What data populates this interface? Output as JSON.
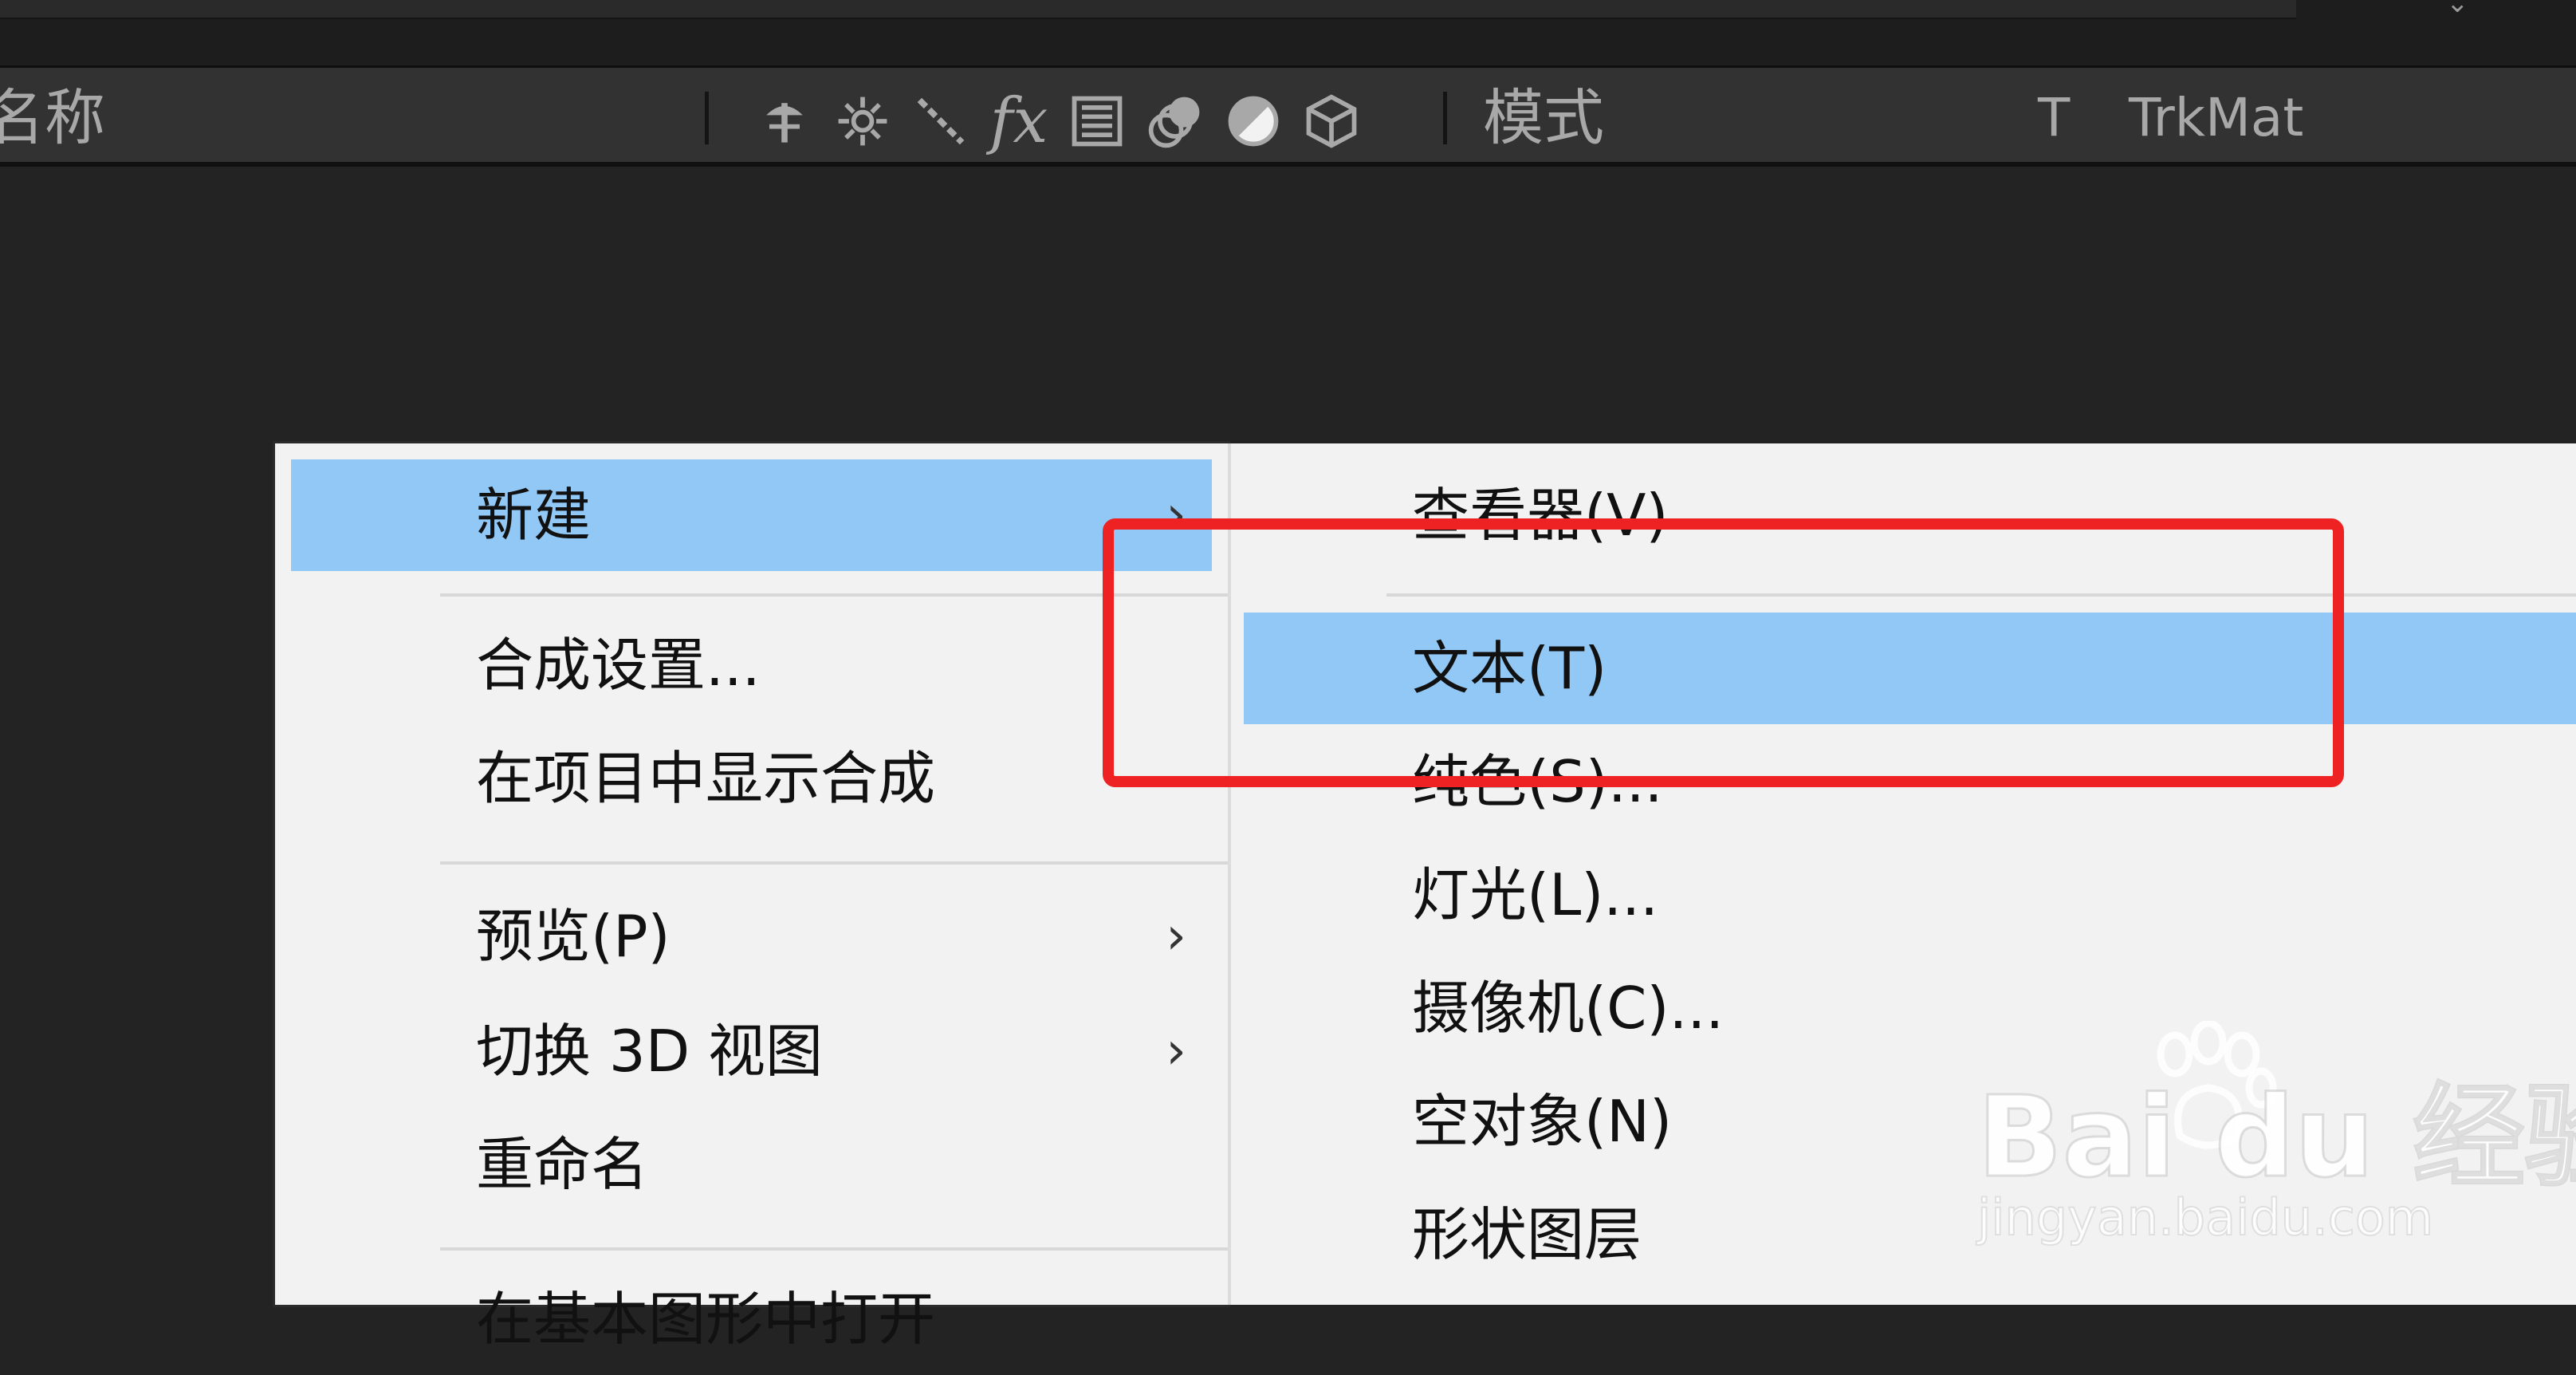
{
  "header": {
    "name_label": "名称",
    "mode_label": "模式",
    "t_label": "T",
    "trkmat_label": "TrkMat",
    "switch_icons": [
      "shy-icon",
      "collapse-icon",
      "quality-icon",
      "effects-icon",
      "frame-blend-icon",
      "motion-blur-icon",
      "adjustment-layer-icon",
      "3d-layer-icon"
    ],
    "fx_glyph": "fx"
  },
  "context_menu": {
    "items": [
      {
        "label": "新建",
        "has_submenu": true,
        "highlighted": true
      },
      {
        "label": "合成设置..."
      },
      {
        "label": "在项目中显示合成"
      },
      {
        "label": "预览(P)",
        "has_submenu": true
      },
      {
        "label": "切换 3D 视图",
        "has_submenu": true
      },
      {
        "label": "重命名"
      },
      {
        "label": "在基本图形中打开"
      }
    ],
    "chevron": "›"
  },
  "submenu": {
    "items": [
      {
        "label": "查看器(V)"
      },
      {
        "label": "文本(T)",
        "highlighted": true
      },
      {
        "label": "纯色(S)..."
      },
      {
        "label": "灯光(L)..."
      },
      {
        "label": "摄像机(C)..."
      },
      {
        "label": "空对象(N)"
      },
      {
        "label": "形状图层"
      }
    ]
  },
  "watermark": {
    "brand": "Bai  du 经验",
    "url": "jingyan.baidu.com"
  },
  "colors": {
    "background": "#232323",
    "header_bg": "#323232",
    "menu_bg": "#f2f2f2",
    "highlight": "#92c8f6",
    "annotation_red": "#ee2222"
  }
}
